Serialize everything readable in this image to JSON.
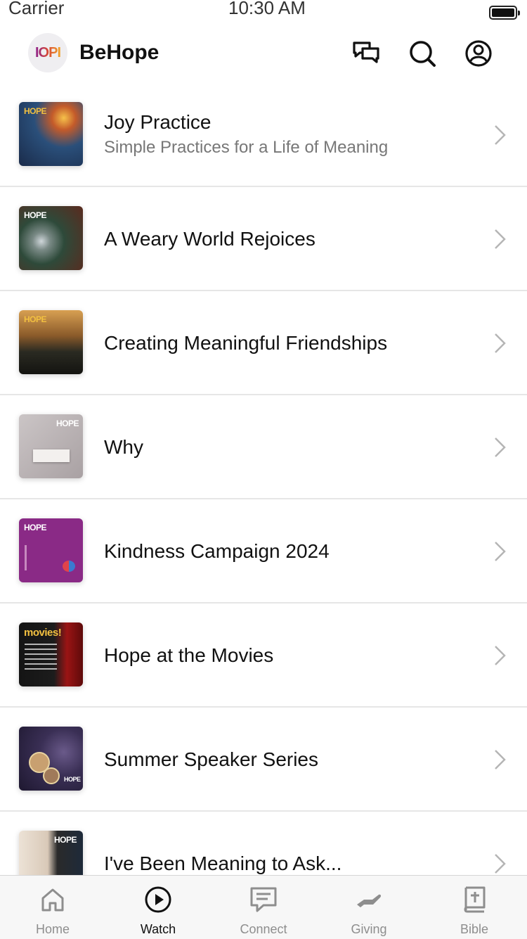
{
  "status_bar": {
    "carrier": "Carrier",
    "time": "10:30 AM"
  },
  "header": {
    "logo_text": "IOPI",
    "title": "BeHope"
  },
  "series": [
    {
      "title": "Joy Practice",
      "subtitle": "Simple Practices for a Life of Meaning",
      "thumb_label": "HOPE"
    },
    {
      "title": "A Weary World Rejoices",
      "thumb_label": "HOPE"
    },
    {
      "title": "Creating Meaningful Friendships",
      "thumb_label": "HOPE"
    },
    {
      "title": "Why",
      "thumb_label": "HOPE"
    },
    {
      "title": "Kindness Campaign 2024",
      "thumb_label": "HOPE"
    },
    {
      "title": "Hope at the Movies",
      "thumb_label": "movies!"
    },
    {
      "title": "Summer Speaker Series",
      "thumb_label": "HOPE"
    },
    {
      "title": "I've Been Meaning to Ask...",
      "thumb_label": "HOPE"
    }
  ],
  "tabs": [
    {
      "label": "Home",
      "icon": "home-icon",
      "active": false
    },
    {
      "label": "Watch",
      "icon": "play-icon",
      "active": true
    },
    {
      "label": "Connect",
      "icon": "message-icon",
      "active": false
    },
    {
      "label": "Giving",
      "icon": "giving-hand-icon",
      "active": false
    },
    {
      "label": "Bible",
      "icon": "bible-icon",
      "active": false
    }
  ],
  "colors": {
    "active": "#111111",
    "inactive": "#8e8e8e",
    "divider": "#e6e6e6",
    "subtitle": "#777777"
  }
}
